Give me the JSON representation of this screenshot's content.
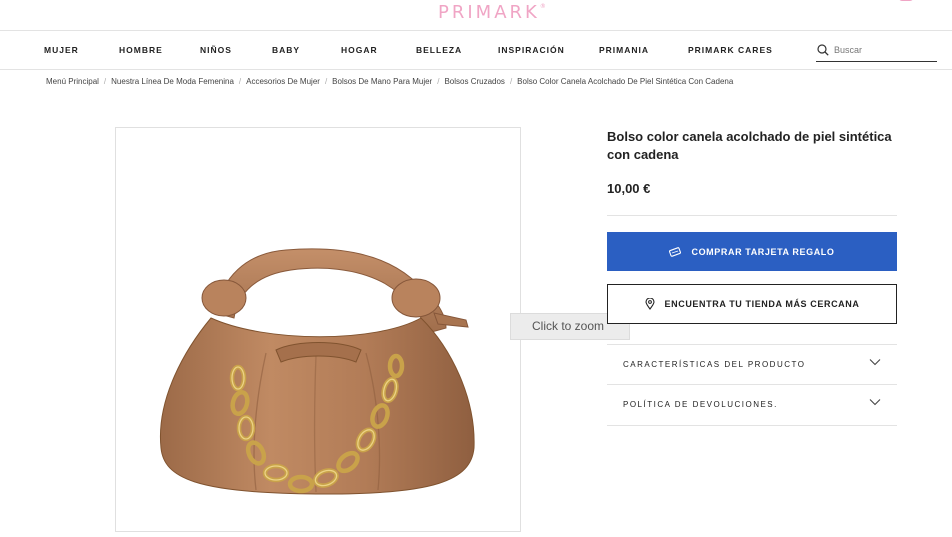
{
  "header": {
    "logo_text": "PRIMARK",
    "logo_mark": "®"
  },
  "nav": {
    "items": [
      "MUJER",
      "HOMBRE",
      "NIÑOS",
      "BABY",
      "HOGAR",
      "BELLEZA",
      "INSPIRACIÓN",
      "PRIMANIA",
      "PRIMARK CARES"
    ],
    "search_placeholder": "Buscar"
  },
  "breadcrumb": [
    "Menú Principal",
    "Nuestra Línea De Moda Femenina",
    "Accesorios De Mujer",
    "Bolsos De Mano Para Mujer",
    "Bolsos Cruzados",
    "Bolso Color Canela Acolchado De Piel Sintética Con Cadena"
  ],
  "breadcrumb_separator": "/",
  "product": {
    "title": "Bolso color canela acolchado de piel sintética con cadena",
    "price": "10,00 €",
    "zoom_hint": "Click to zoom",
    "gift_button": "COMPRAR TARJETA REGALO",
    "store_button": "ENCUENTRA TU TIENDA MÁS CERCANA",
    "accordions": [
      "CARACTERÍSTICAS DEL PRODUCTO",
      "POLÍTICA DE DEVOLUCIONES."
    ]
  },
  "icons": {
    "search": "search-icon",
    "gift": "gift-card-icon",
    "store": "location-pin-icon",
    "chevron": "chevron-down-icon",
    "bag": "shopping-bag-icon"
  },
  "colors": {
    "brand": "#f0a5c5",
    "primary_button": "#2b5fc2",
    "bag_tan": "#b07a55"
  }
}
